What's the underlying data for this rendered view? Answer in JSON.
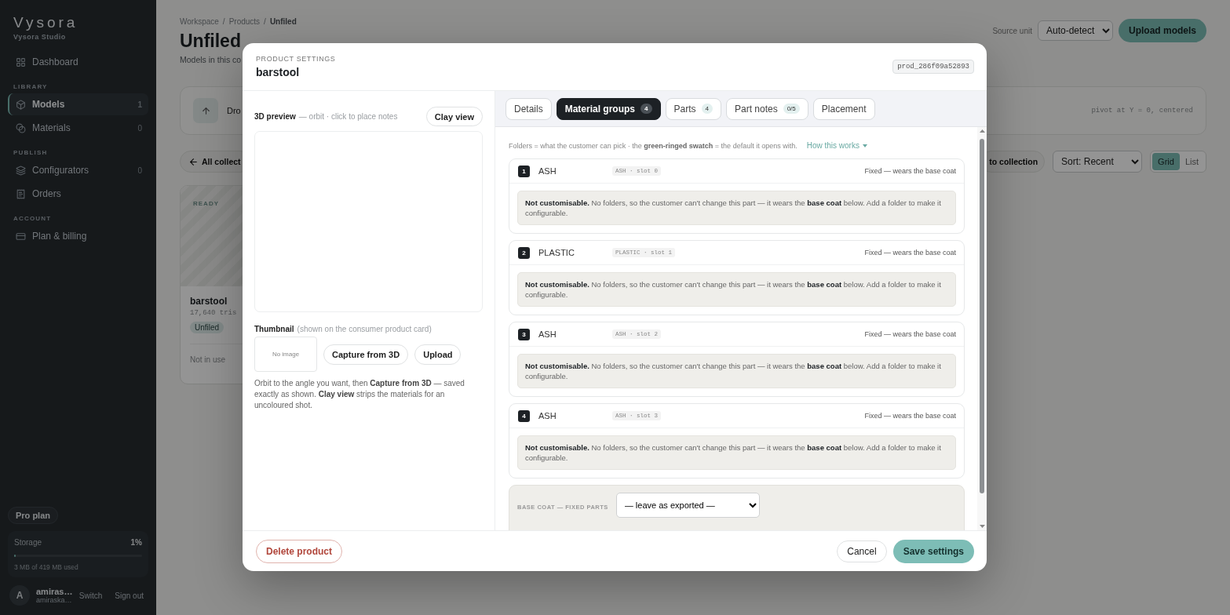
{
  "sidebar": {
    "brand": "Vysora",
    "workspace": "Vysora Studio",
    "nav": [
      {
        "kind": "item",
        "label": "Dashboard",
        "selected": false
      },
      {
        "kind": "heading",
        "label": "LIBRARY"
      },
      {
        "kind": "item",
        "label": "Models",
        "count": "1",
        "selected": true
      },
      {
        "kind": "item",
        "label": "Materials",
        "count": "0",
        "selected": false
      },
      {
        "kind": "heading",
        "label": "PUBLISH"
      },
      {
        "kind": "item",
        "label": "Configurators",
        "count": "0",
        "selected": false
      },
      {
        "kind": "item",
        "label": "Orders",
        "selected": false
      },
      {
        "kind": "heading",
        "label": "ACCOUNT"
      },
      {
        "kind": "item",
        "label": "Plan & billing",
        "selected": false
      }
    ],
    "plan": "Pro plan",
    "storage": {
      "label": "Storage",
      "percent": "1%",
      "level": 0.01,
      "usage": "3 MB of 419 MB used"
    },
    "user": {
      "initial": "A",
      "name": "amiras…",
      "email": "amiraska…",
      "actions": [
        "Switch",
        "Sign out"
      ]
    }
  },
  "page": {
    "breadcrumb": {
      "separator": "/",
      "items": [
        {
          "label": "Workspace",
          "current": false
        },
        {
          "label": "Products",
          "current": false
        },
        {
          "label": "Unfiled",
          "current": true
        }
      ]
    },
    "title": "Unfiled",
    "subtitle": "Models in this co",
    "source_unit": {
      "label": "Source unit",
      "value": "Auto-detect"
    },
    "upload_button": "Upload models",
    "drop_zone": {
      "text": "Dro",
      "note": "pivot at Y = 0, centered"
    },
    "toolbar": {
      "back": "All collect",
      "collection_button": "to collection",
      "sort": "Sort: Recent",
      "views": [
        {
          "label": "Grid",
          "selected": true
        },
        {
          "label": "List",
          "selected": false
        }
      ]
    },
    "cards": [
      {
        "status": "READY",
        "name": "barstool",
        "meta": "17,640 tris",
        "tag": "Unfiled",
        "usage": "Not in use"
      }
    ]
  },
  "modal": {
    "eyebrow": "PRODUCT SETTINGS",
    "title": "barstool",
    "id": "prod_286f09a52893",
    "preview": {
      "title": "3D preview",
      "hint": "— orbit · click to place notes",
      "button": "Clay view"
    },
    "thumbnail": {
      "title": "Thumbnail",
      "hint": "(shown on the consumer product card)",
      "empty": "No image",
      "buttons": [
        "Capture from 3D",
        "Upload"
      ],
      "help": "Orbit to the angle you want, then **Capture from 3D** — saved exactly as shown. **Clay view** strips the materials for an uncoloured shot."
    },
    "tabs": [
      {
        "label": "Details",
        "selected": false
      },
      {
        "label": "Material groups",
        "count": "4",
        "selected": true
      },
      {
        "label": "Parts",
        "count": "4",
        "selected": false
      },
      {
        "label": "Part notes",
        "count": "0/5",
        "selected": false
      },
      {
        "label": "Placement",
        "selected": false
      }
    ],
    "intro": "Folders = what the customer can pick · the **green-ringed swatch** = the default it opens with.",
    "how_link": "How this works",
    "groups": [
      {
        "number": "1",
        "name": "ASH",
        "slot": "ASH · slot 0",
        "status": "Fixed — wears the base coat",
        "note": "**Not customisable.** No folders, so the customer can't change this part — it wears the **base coat** below. Add a folder to make it configurable."
      },
      {
        "number": "2",
        "name": "PLASTIC",
        "slot": "PLASTIC · slot 1",
        "status": "Fixed — wears the base coat",
        "note": "**Not customisable.** No folders, so the customer can't change this part — it wears the **base coat** below. Add a folder to make it configurable."
      },
      {
        "number": "3",
        "name": "ASH",
        "slot": "ASH · slot 2",
        "status": "Fixed — wears the base coat",
        "note": "**Not customisable.** No folders, so the customer can't change this part — it wears the **base coat** below. Add a folder to make it configurable."
      },
      {
        "number": "4",
        "name": "ASH",
        "slot": "ASH · slot 3",
        "status": "Fixed — wears the base coat",
        "note": "**Not customisable.** No folders, so the customer can't change this part — it wears the **base coat** below. Add a folder to make it configurable."
      }
    ],
    "base_coat": {
      "label": "BASE COAT — FIXED PARTS",
      "value": "— leave as exported —"
    },
    "footer": {
      "delete": "Delete product",
      "cancel": "Cancel",
      "save": "Save settings"
    }
  }
}
